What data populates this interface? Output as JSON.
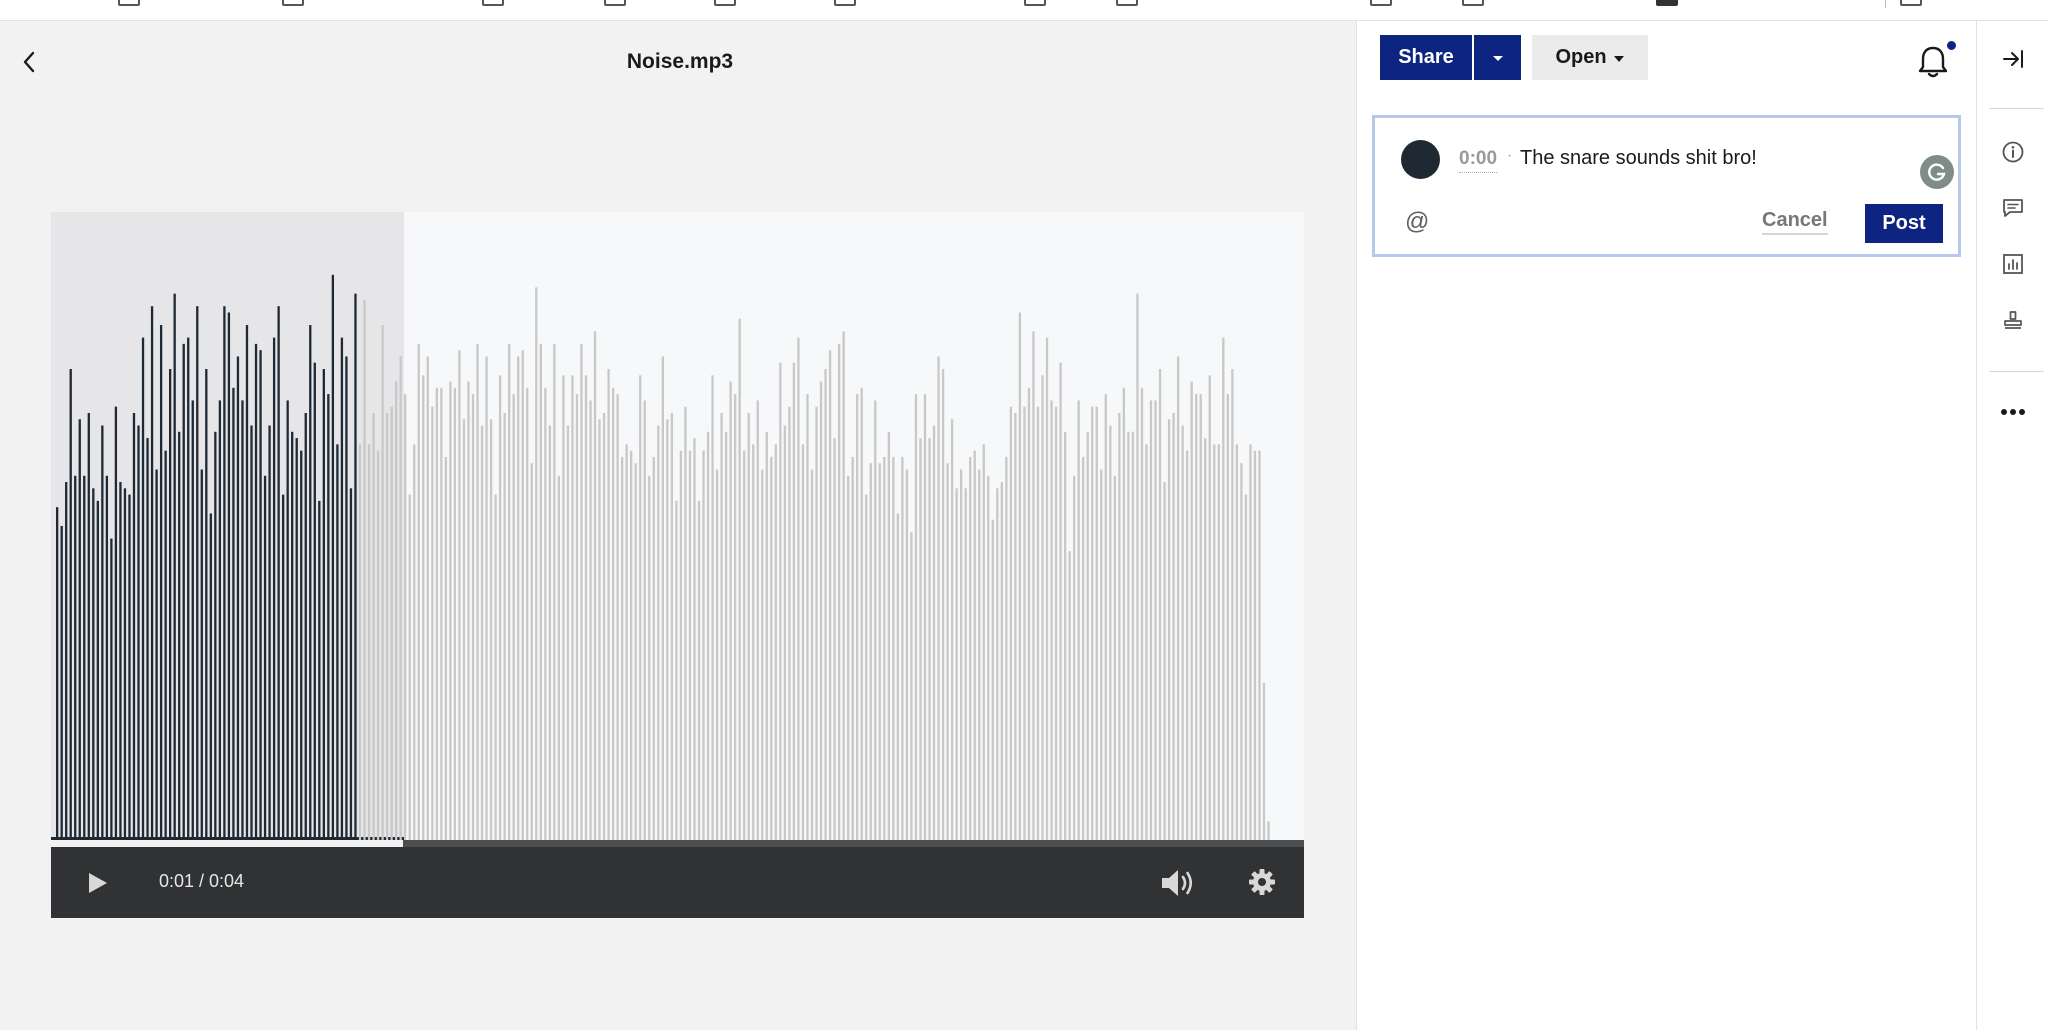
{
  "viewer": {
    "file_title": "Noise.mp3",
    "back_icon": "chevron-left-icon"
  },
  "player": {
    "time_display": "0:01 / 0:04",
    "played_fraction": 0.25,
    "play_icon": "play-icon",
    "volume_icon": "volume-icon",
    "settings_icon": "gear-icon"
  },
  "waveform": {
    "played_color": "#1f2933",
    "unplayed_color": "#c8c8c8",
    "levels": [
      0.53,
      0.5,
      0.57,
      0.75,
      0.58,
      0.67,
      0.58,
      0.68,
      0.56,
      0.54,
      0.66,
      0.58,
      0.48,
      0.69,
      0.57,
      0.56,
      0.55,
      0.68,
      0.66,
      0.8,
      0.64,
      0.85,
      0.59,
      0.82,
      0.62,
      0.75,
      0.87,
      0.65,
      0.79,
      0.8,
      0.7,
      0.85,
      0.59,
      0.75,
      0.52,
      0.65,
      0.7,
      0.85,
      0.84,
      0.72,
      0.77,
      0.7,
      0.82,
      0.66,
      0.79,
      0.78,
      0.58,
      0.66,
      0.8,
      0.85,
      0.55,
      0.7,
      0.65,
      0.64,
      0.62,
      0.68,
      0.82,
      0.76,
      0.54,
      0.75,
      0.71,
      0.9,
      0.63,
      0.8,
      0.77,
      0.56,
      0.87,
      0.63,
      0.86,
      0.63,
      0.68,
      0.62,
      0.82,
      0.68,
      0.69,
      0.73,
      0.77,
      0.71,
      0.55,
      0.63,
      0.79,
      0.74,
      0.77,
      0.69,
      0.72,
      0.72,
      0.61,
      0.73,
      0.72,
      0.78,
      0.67,
      0.73,
      0.71,
      0.79,
      0.66,
      0.77,
      0.67,
      0.55,
      0.74,
      0.68,
      0.79,
      0.71,
      0.77,
      0.78,
      0.72,
      0.6,
      0.88,
      0.79,
      0.72,
      0.66,
      0.79,
      0.58,
      0.74,
      0.66,
      0.74,
      0.71,
      0.79,
      0.74,
      0.7,
      0.81,
      0.67,
      0.68,
      0.75,
      0.72,
      0.71,
      0.61,
      0.63,
      0.62,
      0.6,
      0.74,
      0.7,
      0.58,
      0.61,
      0.66,
      0.77,
      0.67,
      0.68,
      0.54,
      0.62,
      0.69,
      0.62,
      0.64,
      0.54,
      0.62,
      0.65,
      0.74,
      0.59,
      0.68,
      0.65,
      0.73,
      0.71,
      0.83,
      0.62,
      0.68,
      0.63,
      0.7,
      0.59,
      0.65,
      0.61,
      0.63,
      0.76,
      0.66,
      0.69,
      0.76,
      0.8,
      0.63,
      0.71,
      0.59,
      0.69,
      0.73,
      0.75,
      0.78,
      0.64,
      0.79,
      0.81,
      0.58,
      0.61,
      0.71,
      0.72,
      0.55,
      0.6,
      0.7,
      0.6,
      0.61,
      0.65,
      0.61,
      0.52,
      0.61,
      0.59,
      0.49,
      0.71,
      0.64,
      0.71,
      0.64,
      0.66,
      0.77,
      0.75,
      0.6,
      0.67,
      0.56,
      0.59,
      0.56,
      0.61,
      0.62,
      0.59,
      0.63,
      0.58,
      0.51,
      0.56,
      0.57,
      0.61,
      0.69,
      0.68,
      0.84,
      0.69,
      0.72,
      0.81,
      0.69,
      0.74,
      0.8,
      0.7,
      0.69,
      0.76,
      0.65,
      0.46,
      0.58,
      0.7,
      0.61,
      0.65,
      0.69,
      0.69,
      0.59,
      0.71,
      0.66,
      0.58,
      0.68,
      0.72,
      0.65,
      0.65,
      0.87,
      0.72,
      0.63,
      0.7,
      0.7,
      0.75,
      0.57,
      0.67,
      0.68,
      0.77,
      0.66,
      0.62,
      0.73,
      0.71,
      0.71,
      0.64,
      0.74,
      0.63,
      0.63,
      0.8,
      0.71,
      0.75,
      0.63,
      0.6,
      0.55,
      0.63,
      0.62,
      0.62,
      0.25,
      0.03
    ]
  },
  "side_panel": {
    "share_label": "Share",
    "share_menu_icon": "caret-down-icon",
    "open_label": "Open",
    "notification_icon": "bell-icon",
    "comment": {
      "avatar_icon": "avatar",
      "timestamp": "0:00",
      "separator": "·",
      "text": "The snare sounds shit bro!",
      "grammarly_icon": "grammarly-icon",
      "mention_symbol": "@",
      "cancel_label": "Cancel",
      "post_label": "Post"
    }
  },
  "rail": {
    "icons": [
      "collapse-panel-icon",
      "info-icon",
      "comment-icon",
      "chart-icon",
      "stamp-icon",
      "more-icon"
    ]
  },
  "colors": {
    "brand": "#0d2481",
    "player_bar": "#303234"
  }
}
